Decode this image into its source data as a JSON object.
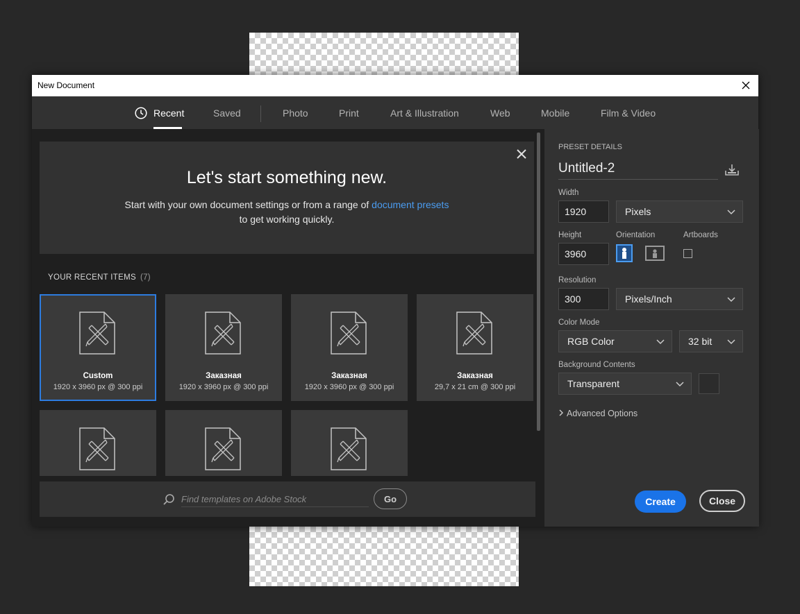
{
  "window": {
    "title": "New Document"
  },
  "tabs": [
    {
      "label": "Recent",
      "active": true
    },
    {
      "label": "Saved"
    },
    {
      "label": "Photo"
    },
    {
      "label": "Print"
    },
    {
      "label": "Art & Illustration"
    },
    {
      "label": "Web"
    },
    {
      "label": "Mobile"
    },
    {
      "label": "Film & Video"
    }
  ],
  "welcome": {
    "heading": "Let's start something new.",
    "line1_pre": "Start with your own document settings or from a range of ",
    "line1_link": "document presets",
    "line2": "to get working quickly."
  },
  "recent": {
    "heading": "YOUR RECENT ITEMS",
    "count": "(7)",
    "items": [
      {
        "name": "Custom",
        "detail": "1920 x 3960 px @ 300 ppi",
        "selected": true
      },
      {
        "name": "Заказная",
        "detail": "1920 x 3960 px @ 300 ppi"
      },
      {
        "name": "Заказная",
        "detail": "1920 x 3960 px @ 300 ppi"
      },
      {
        "name": "Заказная",
        "detail": "29,7 x 21 cm @ 300 ppi"
      },
      {
        "name": "",
        "detail": ""
      },
      {
        "name": "",
        "detail": ""
      },
      {
        "name": "",
        "detail": ""
      }
    ]
  },
  "search": {
    "placeholder": "Find templates on Adobe Stock",
    "go_label": "Go"
  },
  "preset": {
    "heading": "PRESET DETAILS",
    "name": "Untitled-2",
    "width_label": "Width",
    "width_value": "1920",
    "width_unit": "Pixels",
    "height_label": "Height",
    "height_value": "3960",
    "orientation_label": "Orientation",
    "artboards_label": "Artboards",
    "resolution_label": "Resolution",
    "resolution_value": "300",
    "resolution_unit": "Pixels/Inch",
    "color_mode_label": "Color Mode",
    "color_mode": "RGB Color",
    "bit_depth": "32 bit",
    "bg_label": "Background Contents",
    "bg_value": "Transparent",
    "advanced": "Advanced Options"
  },
  "buttons": {
    "create": "Create",
    "close": "Close"
  },
  "colors": {
    "accent": "#1a73e8",
    "link": "#4b9cf0",
    "selection": "#2d7ce0"
  }
}
